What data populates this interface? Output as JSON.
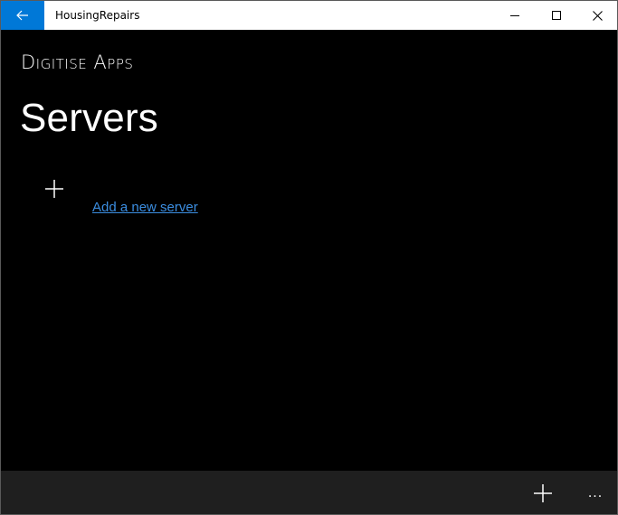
{
  "window": {
    "title": "HousingRepairs"
  },
  "icons": {
    "back": "back-arrow-icon",
    "minimize": "minimize-icon",
    "maximize": "maximize-icon",
    "close": "close-icon",
    "add": "plus-icon",
    "more": "more-icon"
  },
  "colors": {
    "accent": "#0078d7",
    "link": "#3b8de0",
    "background": "#000000",
    "appbar": "#1f1f1f"
  },
  "header": {
    "brand": "Digitise Apps",
    "page_title": "Servers"
  },
  "main": {
    "add_server_label": "Add a new server"
  },
  "appbar": {
    "more_glyph": "..."
  }
}
